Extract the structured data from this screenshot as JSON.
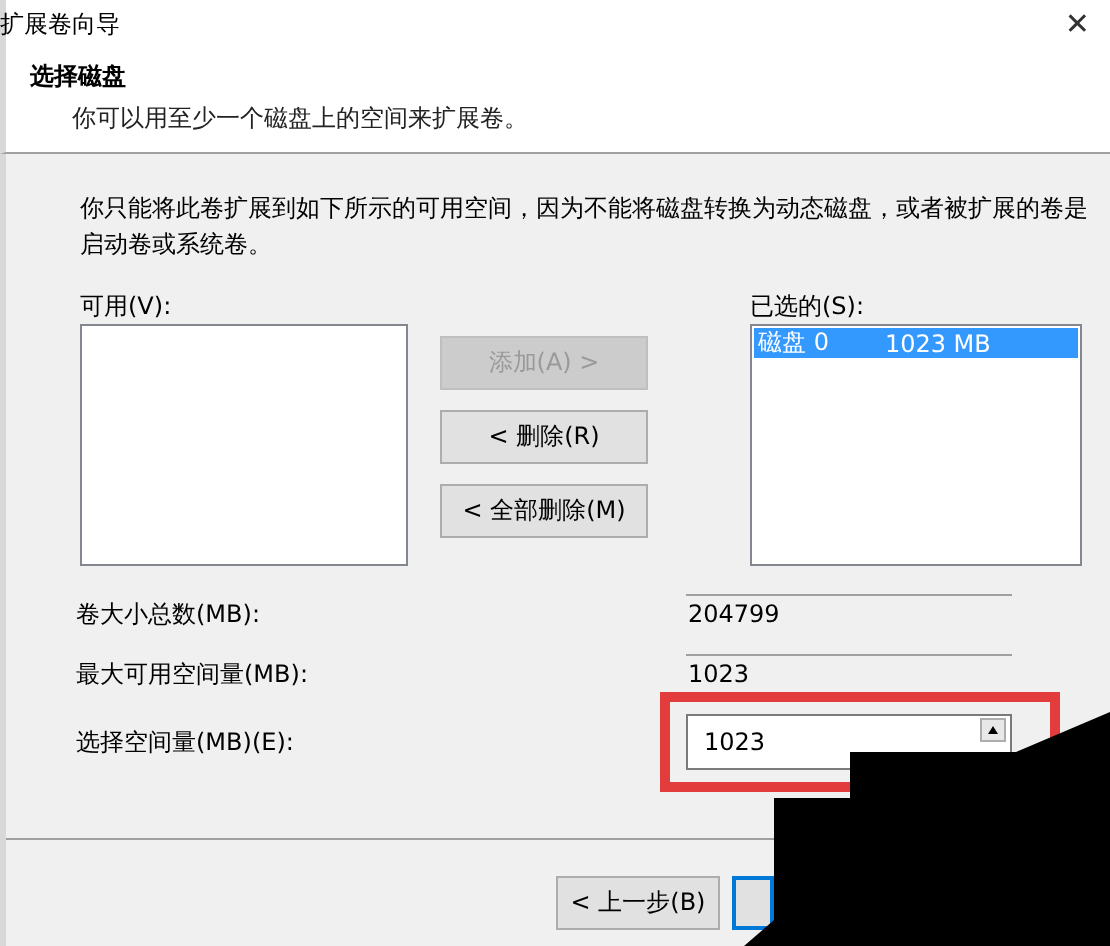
{
  "window": {
    "title": "扩展卷向导",
    "close": "✕"
  },
  "header": {
    "title": "选择磁盘",
    "subtitle": "你可以用至少一个磁盘上的空间来扩展卷。"
  },
  "description": "你只能将此卷扩展到如下所示的可用空间，因为不能将磁盘转换为动态磁盘，或者被扩展的卷是启动卷或系统卷。",
  "available": {
    "label": "可用(V):"
  },
  "selected": {
    "label": "已选的(S):",
    "items": [
      {
        "disk": "磁盘 0",
        "size": "1023 MB",
        "selected": true
      }
    ]
  },
  "buttons": [
    {
      "label": "添加(A) >",
      "disabled": true
    },
    {
      "label": "< 删除(R)",
      "disabled": false
    },
    {
      "label": "< 全部删除(M)",
      "disabled": false
    }
  ],
  "fields": [
    {
      "label": "卷大小总数(MB):",
      "value": "204799",
      "kind": "readonly",
      "highlighted": false
    },
    {
      "label": "最大可用空间量(MB):",
      "value": "1023",
      "kind": "readonly",
      "highlighted": false
    },
    {
      "label": "选择空间量(MB)(E):",
      "value": "1023",
      "kind": "spinner",
      "highlighted": true
    }
  ],
  "footer": {
    "back": "< 上一步(B)"
  }
}
